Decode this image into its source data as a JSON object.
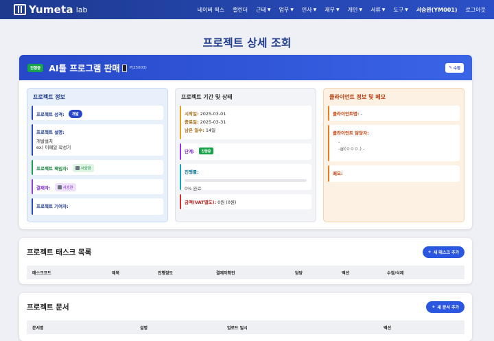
{
  "nav": {
    "logo_main": "Yumeta",
    "logo_sub": "lab",
    "items": [
      {
        "label": "네이버 웍스",
        "dropdown": false
      },
      {
        "label": "캘린더",
        "dropdown": false
      },
      {
        "label": "근태",
        "dropdown": true
      },
      {
        "label": "업무",
        "dropdown": true
      },
      {
        "label": "인사",
        "dropdown": true
      },
      {
        "label": "재무",
        "dropdown": true
      },
      {
        "label": "개인",
        "dropdown": true
      },
      {
        "label": "서류",
        "dropdown": true
      },
      {
        "label": "도구",
        "dropdown": true
      }
    ],
    "user": "서승완(YM001)",
    "logout": "로그아웃"
  },
  "page_title": "프로젝트 상세 조회",
  "project": {
    "status_badge": "진행중",
    "name": "AI툴 프로그램 판매",
    "code": "P(25003)",
    "edit_label": "수정"
  },
  "info_panel": {
    "title": "프로젝트 정보",
    "type_label": "프로젝트 성격:",
    "type_value": "개발",
    "desc_label": "프로젝트 설명:",
    "desc_lines": [
      "개발설치",
      "ex) 이메일 작성기"
    ],
    "manager_label": "프로젝트 책임자:",
    "manager_value": "서승완",
    "approver_label": "결재자:",
    "approver_value": "서승완",
    "contributor_label": "프로젝트 기여자:"
  },
  "period_panel": {
    "title": "프로젝트 기간 및 상태",
    "start_label": "시작일:",
    "start_value": "2025-03-01",
    "end_label": "종료일:",
    "end_value": "2025-03-31",
    "remain_label": "남은 일수:",
    "remain_value": "14일",
    "stage_label": "단계:",
    "stage_value": "진행중",
    "progress_label": "진행률:",
    "progress_pct": 0,
    "progress_text": "0% 완료",
    "amount_label": "금액(VAT별도):",
    "amount_value": "0원 (0원)"
  },
  "client_panel": {
    "title": "클라이언트 정보 및 메모",
    "client_name_label": "클라이언트명:",
    "client_name_value": "-",
    "contact_label": "클라이언트 담당자:",
    "contact_line1": "-",
    "contact_line2": "-@(ㅇㅇㅇ.) -",
    "memo_label": "메모:"
  },
  "tasks": {
    "title": "프로젝트 태스크 목록",
    "add_label": "새 태스크 추가",
    "columns": [
      "태스크코드",
      "제목",
      "진행정도",
      "결재자확인",
      "담당",
      "액션",
      "수정/삭제"
    ]
  },
  "docs": {
    "title": "프로젝트 문서",
    "add_label": "새 문서 추가",
    "columns": [
      "문서명",
      "설명",
      "업로드 일시",
      "액션"
    ]
  }
}
